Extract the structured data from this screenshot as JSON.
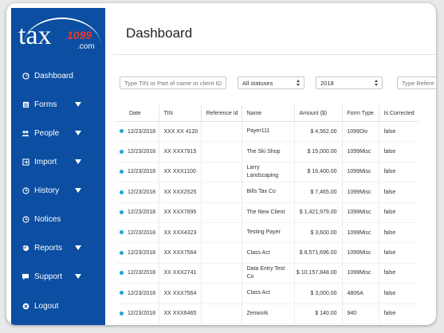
{
  "logo": {
    "brand": "tax",
    "number": "1099",
    "domain": ".com"
  },
  "sidebar": {
    "items": [
      {
        "label": "Dashboard",
        "icon": "dashboard-icon",
        "has_submenu": false
      },
      {
        "label": "Forms",
        "icon": "forms-icon",
        "has_submenu": true
      },
      {
        "label": "People",
        "icon": "people-icon",
        "has_submenu": true
      },
      {
        "label": "Import",
        "icon": "import-icon",
        "has_submenu": true
      },
      {
        "label": "History",
        "icon": "history-icon",
        "has_submenu": true
      },
      {
        "label": "Notices",
        "icon": "notices-icon",
        "has_submenu": false
      },
      {
        "label": "Reports",
        "icon": "reports-icon",
        "has_submenu": true
      },
      {
        "label": "Support",
        "icon": "support-icon",
        "has_submenu": true
      },
      {
        "label": "Logout",
        "icon": "logout-icon",
        "has_submenu": false
      }
    ]
  },
  "main": {
    "title": "Dashboard",
    "filters": {
      "search_placeholder": "Type TIN or Part of name or client ID",
      "status_selected": "All statuses",
      "year_selected": "2018",
      "type_placeholder": "Type Refere"
    },
    "table": {
      "columns": [
        "Date",
        "TIN",
        "Reference Id",
        "Name",
        "Amount ($)",
        "Form Type",
        "Is Corrected"
      ],
      "rows": [
        {
          "date": "12/23/2018",
          "tin": "XXX XX 4120",
          "ref": "",
          "name": "Payer111",
          "amount": "$ 4,562.00",
          "form": "1099Div",
          "corrected": "false"
        },
        {
          "date": "12/23/2018",
          "tin": "XX XXX7915",
          "ref": "",
          "name": "The Ski Shop",
          "amount": "$ 15,000.00",
          "form": "1099Misc",
          "corrected": "false"
        },
        {
          "date": "12/23/2018",
          "tin": "XX XXX1100",
          "ref": "",
          "name": "Larry Landscaping",
          "amount": "$ 16,400.00",
          "form": "1099Misc",
          "corrected": "false"
        },
        {
          "date": "12/23/2018",
          "tin": "XX XXX2525",
          "ref": "",
          "name": "Bills Tax Co",
          "amount": "$ 7,465.00",
          "form": "1099Misc",
          "corrected": "false"
        },
        {
          "date": "12/23/2018",
          "tin": "XX XXX7895",
          "ref": "",
          "name": "The New Client",
          "amount": "$ 1,421,979.00",
          "form": "1099Misc",
          "corrected": "false"
        },
        {
          "date": "12/23/2018",
          "tin": "XX XXX4323",
          "ref": "",
          "name": "Testing Payer",
          "amount": "$ 3,600.00",
          "form": "1099Misc",
          "corrected": "false"
        },
        {
          "date": "12/23/2018",
          "tin": "XX XXX7564",
          "ref": "",
          "name": "Class Act",
          "amount": "$ 8,571,696.00",
          "form": "1099Misc",
          "corrected": "false"
        },
        {
          "date": "12/23/2018",
          "tin": "XX XXX2741",
          "ref": "",
          "name": "Data Entry Test Co",
          "amount": "$ 10,157,848.00",
          "form": "1099Misc",
          "corrected": "false"
        },
        {
          "date": "12/23/2018",
          "tin": "XX XXX7564",
          "ref": "",
          "name": "Class Act",
          "amount": "$ 3,000.00",
          "form": "4806A",
          "corrected": "false"
        },
        {
          "date": "12/23/2018",
          "tin": "XX XXX6465",
          "ref": "",
          "name": "Zenwork",
          "amount": "$ 140.00",
          "form": "940",
          "corrected": "false"
        }
      ]
    }
  },
  "colors": {
    "sidebar": "#0b4ea2",
    "accent_dot": "#1aa7d8",
    "logo_number": "#e23b2e"
  }
}
